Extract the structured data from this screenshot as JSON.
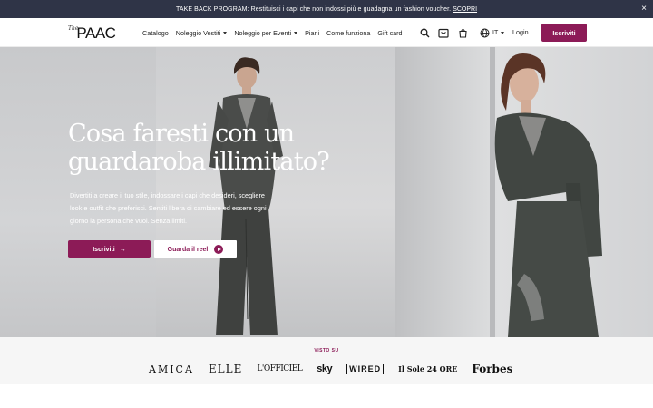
{
  "announcement": {
    "text": "TAKE BACK PROGRAM: Restituisci i capi che non indossi più e guadagna un fashion voucher.",
    "link": "SCOPRI",
    "close": "×"
  },
  "header": {
    "logo_the": "The",
    "logo_word": "PAAC",
    "menu": [
      {
        "label": "Catalogo",
        "dropdown": false
      },
      {
        "label": "Noleggio Vestiti",
        "dropdown": true
      },
      {
        "label": "Noleggio per Eventi",
        "dropdown": true
      },
      {
        "label": "Piani",
        "dropdown": false
      },
      {
        "label": "Come funziona",
        "dropdown": false
      },
      {
        "label": "Gift card",
        "dropdown": false
      }
    ],
    "icons": [
      "search-icon",
      "wardrobe-box-icon",
      "shopping-bag-icon",
      "globe-icon"
    ],
    "language": "IT",
    "login": "Login",
    "signup": "Iscriviti"
  },
  "hero": {
    "title_line1": "Cosa faresti con un",
    "title_line2": "guardaroba illimitato?",
    "subtitle_line1": "Divertiti a creare il tuo stile, indossare i capi che desideri, scegliere",
    "subtitle_line2": "look e outfit che preferisci. Sentiti libera di cambiare ed essere ogni",
    "subtitle_line3": "giorno la persona che vuoi. Senza limiti.",
    "primary_button": "Iscriviti",
    "primary_arrow": "→",
    "secondary_button": "Guarda il reel"
  },
  "press": {
    "label": "VISTO SU",
    "logos": [
      "AMICA",
      "ELLE",
      "L'OFFICIEL",
      "sky",
      "WIRED",
      "Il Sole 24 ORE",
      "Forbes"
    ]
  },
  "colors": {
    "accent": "#8c1b57",
    "topbar": "#2f3447"
  }
}
